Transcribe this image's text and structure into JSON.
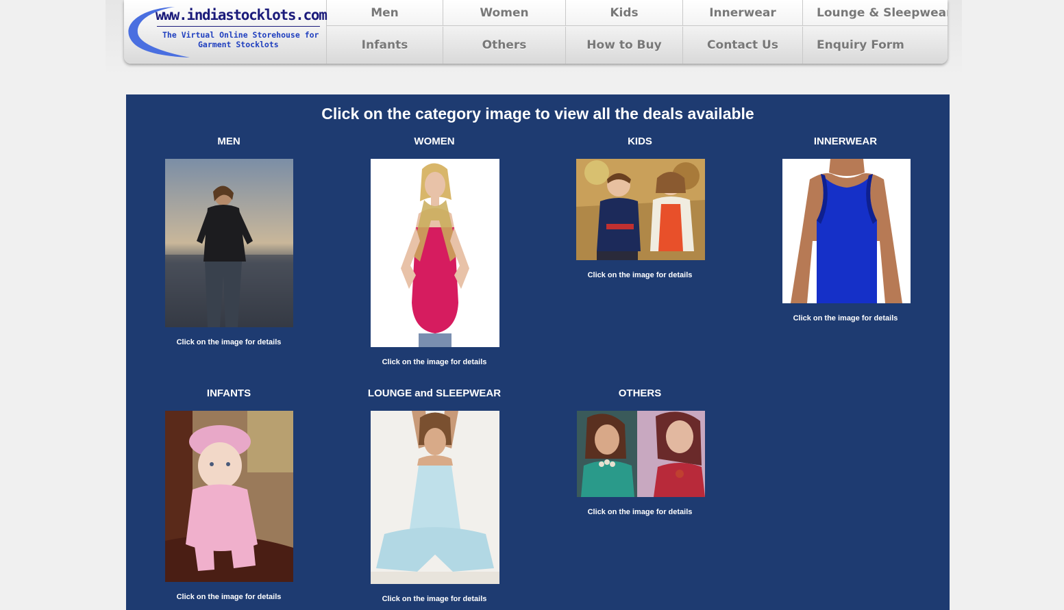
{
  "logo": {
    "domain": "www.indiastocklots.com",
    "tagline_line1": "The Virtual Online Storehouse for",
    "tagline_line2": "Garment Stocklots"
  },
  "nav": {
    "row1": [
      "Men",
      "Women",
      "Kids",
      "Innerwear",
      "Lounge & Sleepwear"
    ],
    "row2": [
      "Infants",
      "Others",
      "How to Buy",
      "Contact Us",
      "Enquiry Form"
    ]
  },
  "main": {
    "heading": "Click on the category image to view all the deals available",
    "categories": [
      {
        "title": "MEN",
        "caption": "Click on the image for details",
        "image": "man-on-beach-photo"
      },
      {
        "title": "WOMEN",
        "caption": "Click on the image for details",
        "image": "woman-pink-top-photo"
      },
      {
        "title": "KIDS",
        "caption": "Click on the image for details",
        "image": "two-children-photo"
      },
      {
        "title": "INNERWEAR",
        "caption": "Click on the image for details",
        "image": "blue-vest-photo"
      },
      {
        "title": "INFANTS",
        "caption": "Click on the image for details",
        "image": "baby-pink-knit-photo"
      },
      {
        "title": "LOUNGE and SLEEPWEAR",
        "caption": "Click on the image for details",
        "image": "woman-loungewear-photo"
      },
      {
        "title": "OTHERS",
        "caption": "Click on the image for details",
        "image": "two-women-accessories-photo"
      }
    ]
  },
  "colors": {
    "content_bg": "#1e3b71",
    "page_bg": "#f0f0f0",
    "logo_blue": "#1a1a7a",
    "nav_text": "#787878"
  }
}
